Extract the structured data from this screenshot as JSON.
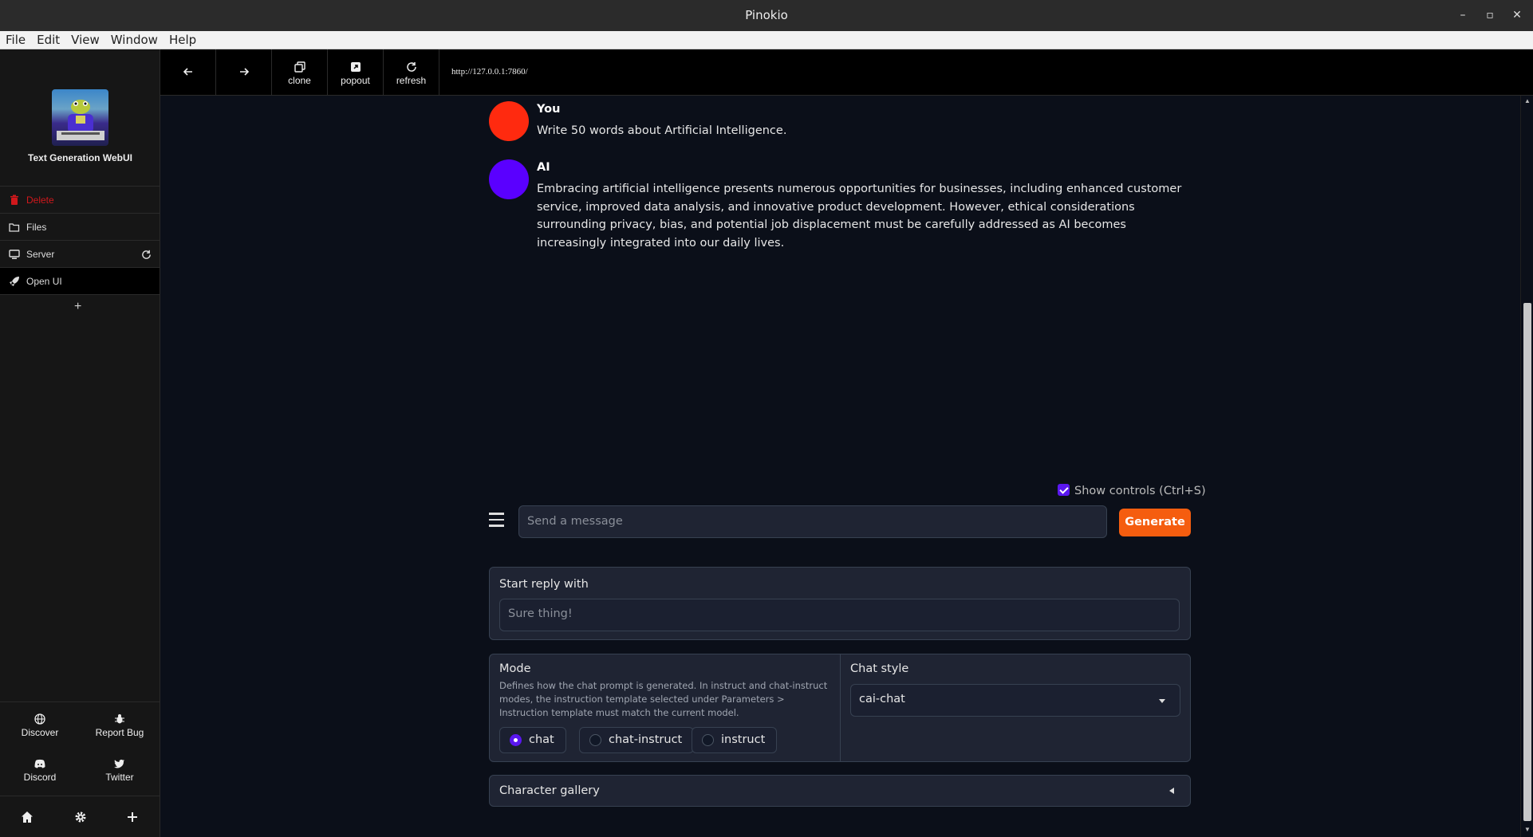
{
  "window": {
    "title": "Pinokio",
    "minimize": "–",
    "maximize": "▫",
    "close": "✕"
  },
  "menu": [
    "File",
    "Edit",
    "View",
    "Window",
    "Help"
  ],
  "sidebar": {
    "app_title": "Text Generation WebUI",
    "items": [
      {
        "label": "Delete",
        "icon": "trash-icon",
        "color": "#d0181c"
      },
      {
        "label": "Files",
        "icon": "folder-icon"
      },
      {
        "label": "Server",
        "icon": "monitor-icon"
      },
      {
        "label": "Open UI",
        "icon": "rocket-icon"
      }
    ],
    "add": "+",
    "bottom": [
      {
        "label": "Discover",
        "icon": "globe-icon"
      },
      {
        "label": "Report Bug",
        "icon": "bug-icon"
      },
      {
        "label": "Discord",
        "icon": "discord-icon"
      },
      {
        "label": "Twitter",
        "icon": "twitter-icon"
      }
    ]
  },
  "toolbar": {
    "clone": "clone",
    "popout": "popout",
    "refresh": "refresh",
    "url": "http://127.0.0.1:7860/"
  },
  "chat": {
    "messages": [
      {
        "name": "You",
        "text": "Write 50 words about Artificial Intelligence.",
        "avatar_color": "#ff2a0f"
      },
      {
        "name": "AI",
        "text": "Embracing artificial intelligence presents numerous opportunities for businesses, including enhanced customer service, improved data analysis, and innovative product development. However, ethical considerations surrounding privacy, bias, and potential job displacement must be carefully addressed as AI becomes increasingly integrated into our daily lives.",
        "avatar_color": "#5a00ff"
      }
    ],
    "show_controls": "Show controls (Ctrl+S)",
    "input_placeholder": "Send a message",
    "generate": "Generate"
  },
  "controls": {
    "start_reply_label": "Start reply with",
    "start_reply_placeholder": "Sure thing!",
    "mode_label": "Mode",
    "mode_desc": "Defines how the chat prompt is generated. In instruct and chat-instruct modes, the instruction template selected under Parameters > Instruction template must match the current model.",
    "modes": [
      "chat",
      "chat-instruct",
      "instruct"
    ],
    "selected_mode": "chat",
    "chat_style_label": "Chat style",
    "chat_style_value": "cai-chat",
    "gallery_label": "Character gallery"
  }
}
